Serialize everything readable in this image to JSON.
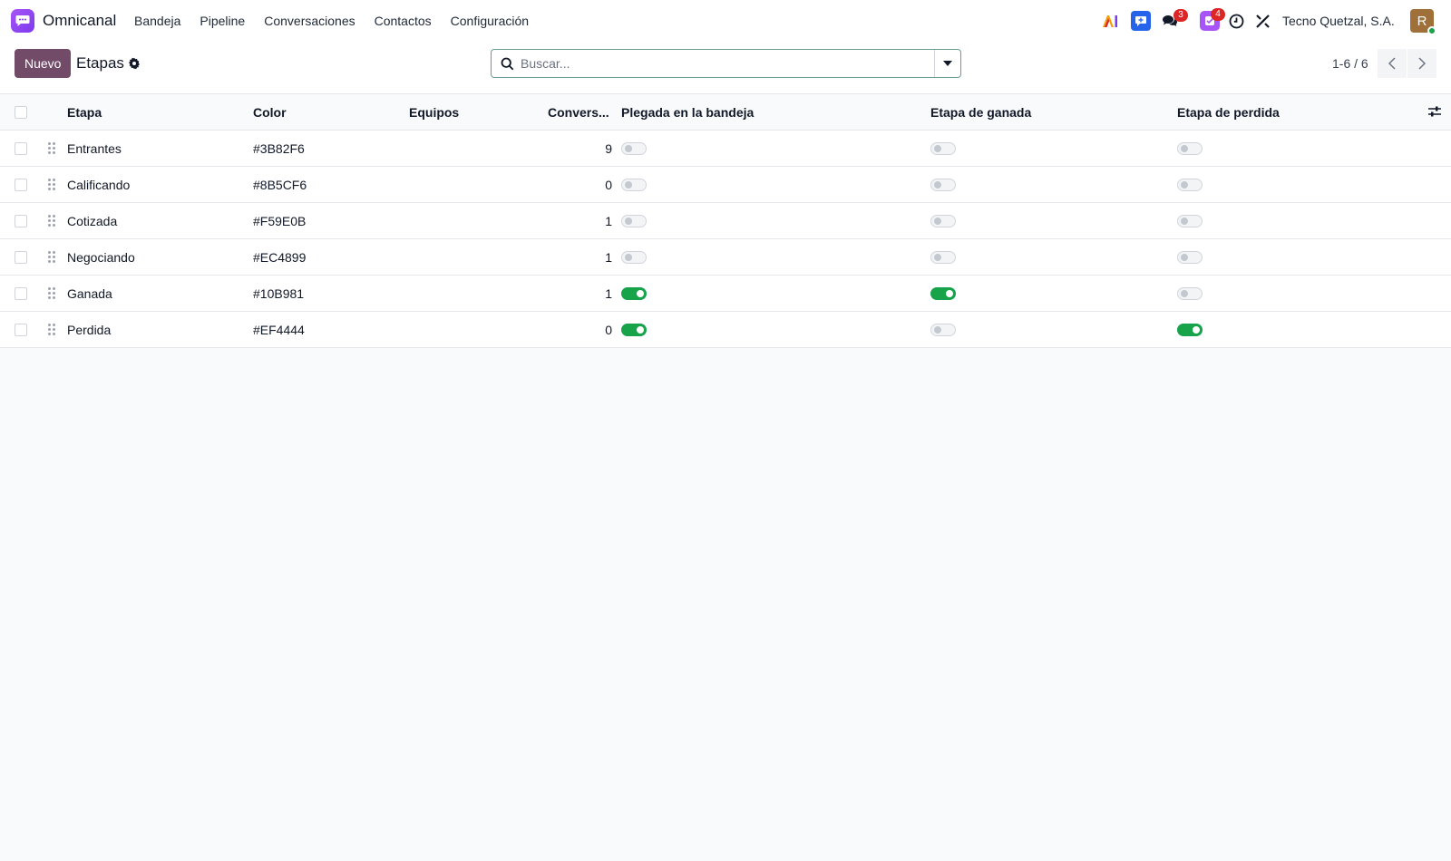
{
  "navbar": {
    "app_name": "Omnicanal",
    "menu": [
      "Bandeja",
      "Pipeline",
      "Conversaciones",
      "Contactos",
      "Configuración"
    ],
    "chat_badge": "3",
    "activity_badge": "4",
    "company": "Tecno Quetzal, S.A.",
    "avatar_initial": "R"
  },
  "control": {
    "new_label": "Nuevo",
    "title": "Etapas",
    "search_placeholder": "Buscar...",
    "pager": "1-6 / 6"
  },
  "table": {
    "headers": {
      "etapa": "Etapa",
      "color": "Color",
      "equipos": "Equipos",
      "conversaciones": "Convers...",
      "plegada": "Plegada en la bandeja",
      "ganada": "Etapa de ganada",
      "perdida": "Etapa de perdida"
    },
    "rows": [
      {
        "etapa": "Entrantes",
        "color": "#3B82F6",
        "equipos": "",
        "conversaciones": "9",
        "plegada": false,
        "ganada": false,
        "perdida": false
      },
      {
        "etapa": "Calificando",
        "color": "#8B5CF6",
        "equipos": "",
        "conversaciones": "0",
        "plegada": false,
        "ganada": false,
        "perdida": false
      },
      {
        "etapa": "Cotizada",
        "color": "#F59E0B",
        "equipos": "",
        "conversaciones": "1",
        "plegada": false,
        "ganada": false,
        "perdida": false
      },
      {
        "etapa": "Negociando",
        "color": "#EC4899",
        "equipos": "",
        "conversaciones": "1",
        "plegada": false,
        "ganada": false,
        "perdida": false
      },
      {
        "etapa": "Ganada",
        "color": "#10B981",
        "equipos": "",
        "conversaciones": "1",
        "plegada": true,
        "ganada": true,
        "perdida": false
      },
      {
        "etapa": "Perdida",
        "color": "#EF4444",
        "equipos": "",
        "conversaciones": "0",
        "plegada": true,
        "ganada": false,
        "perdida": true
      }
    ]
  },
  "colors": {
    "primary": "#714b67",
    "toggle_on": "#16a34a",
    "badge": "#dc2626"
  }
}
